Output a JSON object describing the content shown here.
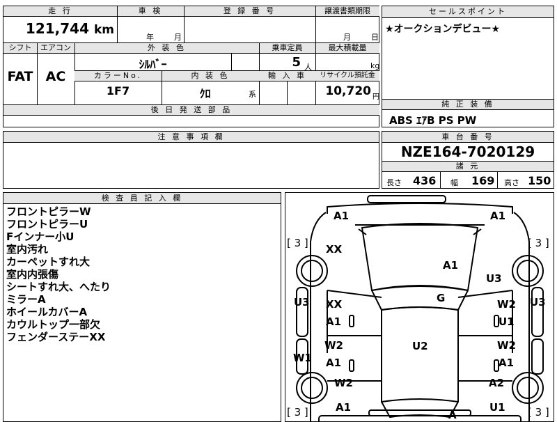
{
  "top": {
    "mileage_header": "走 行",
    "mileage_value": "121,744",
    "mileage_unit": "km",
    "shaken_header": "車 検",
    "shaken_year": "年",
    "shaken_month": "月",
    "reg_header": "登 録 番 号",
    "transfer_header": "譲渡書類期限",
    "transfer_month": "月",
    "transfer_day": "日",
    "sales_header": "セールスポイント",
    "sales_text": "★オークションデビュー★"
  },
  "spec": {
    "shift_header": "シフト",
    "shift_value": "FAT",
    "aircon_header": "エアコン",
    "aircon_value": "AC",
    "exterior_header": "外 装 色",
    "exterior_value": "ｼﾙﾊﾞｰ",
    "color_no_header": "カラーNo.",
    "color_no_value": "1F7",
    "interior_header": "内 装 色",
    "interior_value": "ｸﾛ",
    "interior_suffix": "系",
    "capacity_header": "乗車定員",
    "capacity_value": "5",
    "capacity_unit": "人",
    "import_header": "輸 入 車",
    "load_header": "最大積載量",
    "load_unit": "kg",
    "recycle_header": "リサイクル預託金",
    "recycle_value": "10,720",
    "recycle_unit": "円",
    "later_parts_header": "後 日 発 送 部 品"
  },
  "equipment": {
    "header": "純 正 装 備",
    "value": "ABS ｴｱB PS PW"
  },
  "notes": {
    "header": "注 意 事 項 欄"
  },
  "chassis": {
    "header": "車 台 番 号",
    "value": "NZE164-7020129",
    "dims_header": "諸 元",
    "length_label": "長さ",
    "length_value": "436",
    "width_label": "幅",
    "width_value": "169",
    "height_label": "高さ",
    "height_value": "150"
  },
  "inspector": {
    "header": "検 査 員 記 入 欄",
    "items": [
      "フロントピラーW",
      "フロントピラーU",
      "Fインナー小U",
      "室内汚れ",
      "カーペットすれ大",
      "室内内張傷",
      "シートすれ大、へたり",
      "ミラーA",
      "ホイールカバーA",
      "カウルトップ一部欠",
      "フェンダーステーXX"
    ]
  },
  "diagram": {
    "marks": [
      {
        "id": "a1-front-left",
        "text": "A1"
      },
      {
        "id": "a1-front-right",
        "text": "A1"
      },
      {
        "id": "tread-fl",
        "text": "[ 3 ]"
      },
      {
        "id": "tread-fr",
        "text": "[ 3 ]"
      },
      {
        "id": "xx-fender-left",
        "text": "XX"
      },
      {
        "id": "a1-hood",
        "text": "A1"
      },
      {
        "id": "u3-fender-right",
        "text": "U3"
      },
      {
        "id": "u3-side-left",
        "text": "U3"
      },
      {
        "id": "u3-side-right",
        "text": "U3"
      },
      {
        "id": "g-windshield",
        "text": "G"
      },
      {
        "id": "xx-front-door-left",
        "text": "XX"
      },
      {
        "id": "a1-front-door-left",
        "text": "A1"
      },
      {
        "id": "w2-front-door-right",
        "text": "W2"
      },
      {
        "id": "u1-front-door-right",
        "text": "U1"
      },
      {
        "id": "u2-roof",
        "text": "U2"
      },
      {
        "id": "w2-rear-door-left",
        "text": "W2"
      },
      {
        "id": "a1-rear-door-left",
        "text": "A1"
      },
      {
        "id": "w2-rear-door-right",
        "text": "W2"
      },
      {
        "id": "a1-rear-door-right",
        "text": "A1"
      },
      {
        "id": "w1-side-left",
        "text": "W1"
      },
      {
        "id": "w2-quarter-left",
        "text": "W2"
      },
      {
        "id": "a2-quarter-right",
        "text": "A2"
      },
      {
        "id": "tread-rl",
        "text": "[ 3 ]"
      },
      {
        "id": "tread-rr",
        "text": "[ 3 ]"
      },
      {
        "id": "a1-rear-left",
        "text": "A1"
      },
      {
        "id": "a-rear-bumper",
        "text": "A"
      },
      {
        "id": "u1-rear-right",
        "text": "U1"
      }
    ]
  }
}
